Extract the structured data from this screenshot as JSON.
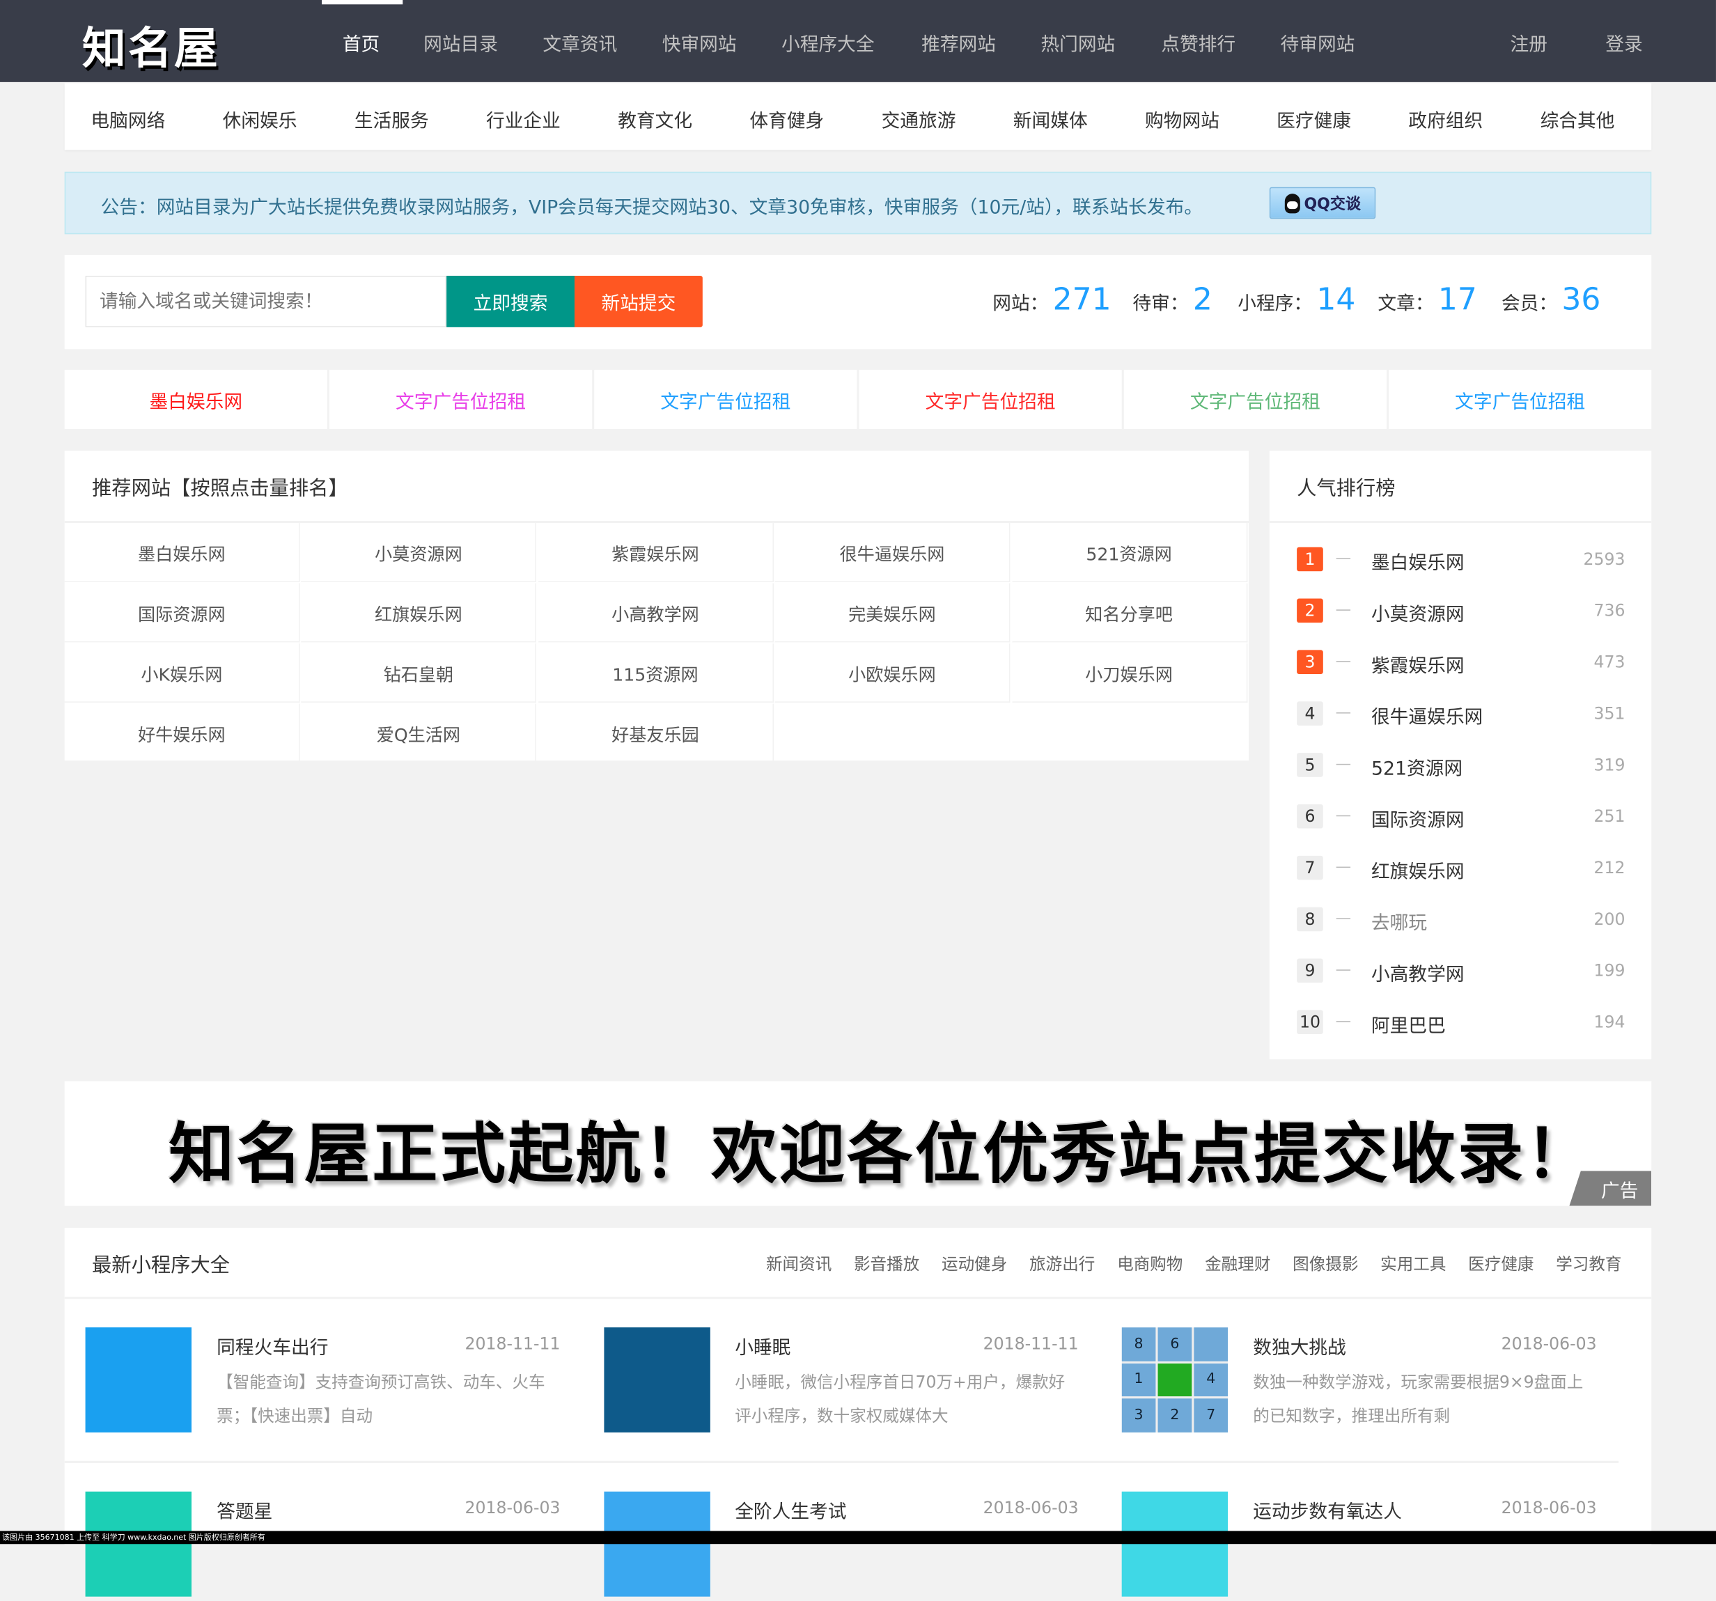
{
  "header": {
    "logo": "知名屋",
    "nav": [
      "首页",
      "网站目录",
      "文章资讯",
      "快审网站",
      "小程序大全",
      "推荐网站",
      "热门网站",
      "点赞排行",
      "待审网站"
    ],
    "active_nav": "首页",
    "register": "注册",
    "login": "登录"
  },
  "categories": [
    "电脑网络",
    "休闲娱乐",
    "生活服务",
    "行业企业",
    "教育文化",
    "体育健身",
    "交通旅游",
    "新闻媒体",
    "购物网站",
    "医疗健康",
    "政府组织",
    "综合其他"
  ],
  "notice": {
    "text": "公告：网站目录为广大站长提供免费收录网站服务，VIP会员每天提交网站30、文章30免审核，快审服务（10元/站），联系站长发布。",
    "qq_button": "QQ交谈"
  },
  "search": {
    "placeholder": "请输入域名或关键词搜索！",
    "search_button": "立即搜索",
    "submit_button": "新站提交"
  },
  "stats": [
    {
      "label": "网站：",
      "value": "271"
    },
    {
      "label": "待审：",
      "value": "2"
    },
    {
      "label": "小程序：",
      "value": "14"
    },
    {
      "label": "文章：",
      "value": "17"
    },
    {
      "label": "会员：",
      "value": "36"
    }
  ],
  "ad_links": [
    {
      "text": "墨白娱乐网",
      "color": "#ff1a1a"
    },
    {
      "text": "文字广告位招租",
      "color": "#e83ee8"
    },
    {
      "text": "文字广告位招租",
      "color": "#1e9fff"
    },
    {
      "text": "文字广告位招租",
      "color": "#ff2a2a"
    },
    {
      "text": "文字广告位招租",
      "color": "#5fb878"
    },
    {
      "text": "文字广告位招租",
      "color": "#1e9fff"
    }
  ],
  "recommended": {
    "title": "推荐网站【按照点击量排名】",
    "sites": [
      "墨白娱乐网",
      "小莫资源网",
      "紫霞娱乐网",
      "很牛逼娱乐网",
      "521资源网",
      "国际资源网",
      "红旗娱乐网",
      "小高教学网",
      "完美娱乐网",
      "知名分享吧",
      "小K娱乐网",
      "钻石皇朝",
      "115资源网",
      "小欧娱乐网",
      "小刀娱乐网",
      "好牛娱乐网",
      "爱Q生活网",
      "好基友乐园"
    ]
  },
  "ranking": {
    "title": "人气排行榜",
    "items": [
      {
        "rank": "1",
        "name": "墨白娱乐网",
        "count": "2593"
      },
      {
        "rank": "2",
        "name": "小莫资源网",
        "count": "736"
      },
      {
        "rank": "3",
        "name": "紫霞娱乐网",
        "count": "473"
      },
      {
        "rank": "4",
        "name": "很牛逼娱乐网",
        "count": "351"
      },
      {
        "rank": "5",
        "name": "521资源网",
        "count": "319"
      },
      {
        "rank": "6",
        "name": "国际资源网",
        "count": "251"
      },
      {
        "rank": "7",
        "name": "红旗娱乐网",
        "count": "212"
      },
      {
        "rank": "8",
        "name": "去哪玩",
        "count": "200"
      },
      {
        "rank": "9",
        "name": "小高教学网",
        "count": "199"
      },
      {
        "rank": "10",
        "name": "阿里巴巴",
        "count": "194"
      }
    ]
  },
  "banner": {
    "text": "知名屋正式起航！欢迎各位优秀站点提交收录！",
    "tag": "广告"
  },
  "mini_programs": {
    "title": "最新小程序大全",
    "categories": [
      "新闻资讯",
      "影音播放",
      "运动健身",
      "旅游出行",
      "电商购物",
      "金融理财",
      "图像摄影",
      "实用工具",
      "医疗健康",
      "学习教育"
    ],
    "items": [
      {
        "name": "同程火车出行",
        "date": "2018-11-11",
        "desc": "【智能查询】支持查询预订高铁、动车、火车票；【快速出票】自动",
        "thumb_color": "#1aa0f0"
      },
      {
        "name": "小睡眠",
        "date": "2018-11-11",
        "desc": "小睡眠，微信小程序首日70万+用户，爆款好评小程序，数十家权威媒体大",
        "thumb_color": "#0e5a8a"
      },
      {
        "name": "数独大挑战",
        "date": "2018-06-03",
        "desc": "数独一种数学游戏，玩家需要根据9×9盘面上的已知数字，推理出所有剩",
        "thumb_color": "#6fa9d8",
        "grid": [
          "8",
          "6",
          "",
          "1",
          "",
          "4",
          "3",
          "2",
          "7"
        ]
      },
      {
        "name": "答题星",
        "date": "2018-06-03",
        "desc": "",
        "thumb_color": "#1ccfb5"
      },
      {
        "name": "全阶人生考试",
        "date": "2018-06-03",
        "desc": "",
        "thumb_color": "#3aa8f0"
      },
      {
        "name": "运动步数有氧达人",
        "date": "2018-06-03",
        "desc": "",
        "thumb_color": "#3fd8e6"
      }
    ]
  },
  "watermark": "该图片由 35671081 上传至 科学刀 www.kxdao.net 图片版权归原创者所有"
}
